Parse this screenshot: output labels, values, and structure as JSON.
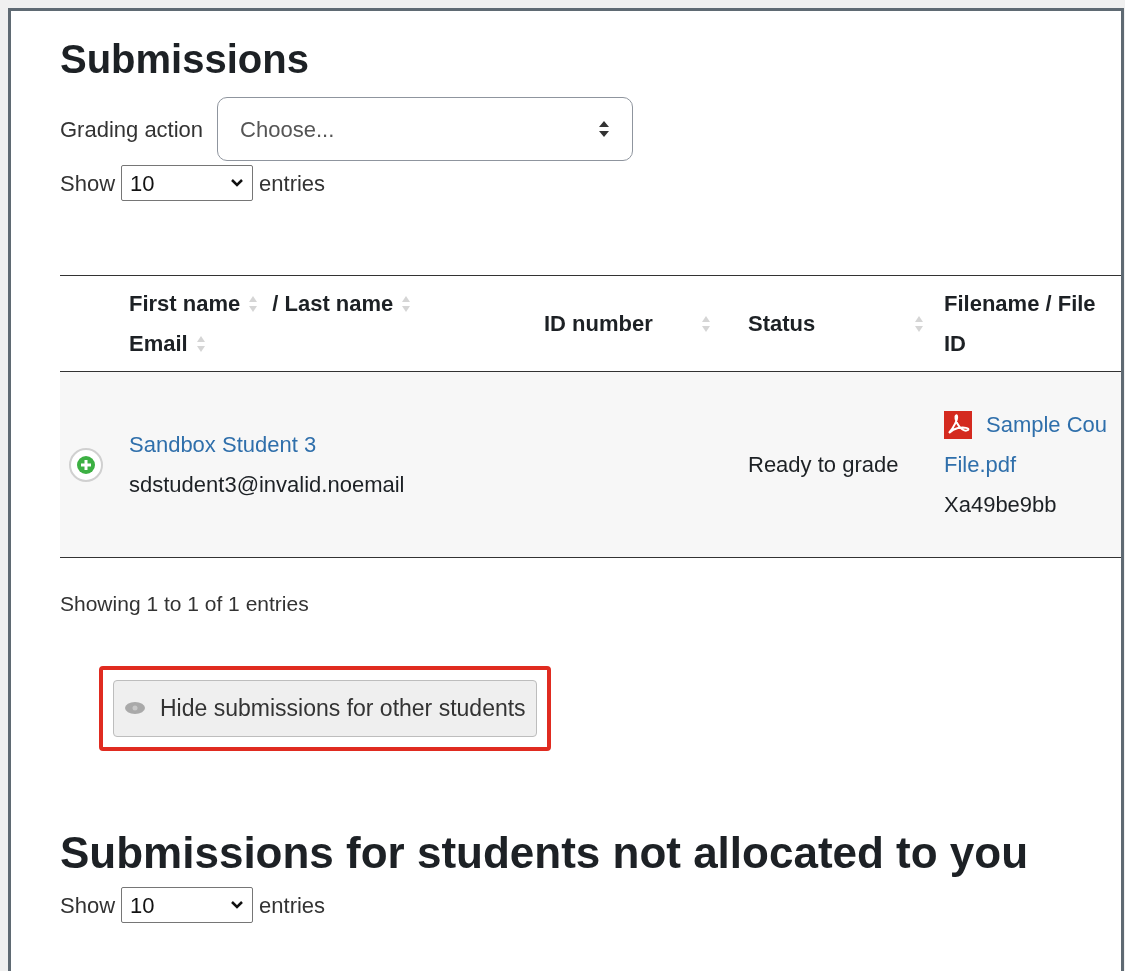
{
  "heading": "Submissions",
  "grading_action": {
    "label": "Grading action",
    "placeholder": "Choose..."
  },
  "show_entries": {
    "before": "Show",
    "value": "10",
    "after": "entries"
  },
  "table": {
    "columns": [
      {
        "kind": "name",
        "parts": [
          "First name",
          "/ Last name",
          "Email"
        ]
      },
      {
        "kind": "plain",
        "label": "ID number"
      },
      {
        "kind": "plain",
        "label": "Status"
      },
      {
        "kind": "file",
        "label": "Filename / File ID"
      }
    ],
    "rows": [
      {
        "expanded": false,
        "name": "Sandbox Student 3",
        "email": "sdstudent3@invalid.noemail",
        "id_number": "",
        "status": "Ready to grade",
        "file_lines": [
          "Sample Cou",
          "File.pdf"
        ],
        "file_id": "Xa49be9bb"
      }
    ]
  },
  "info": "Showing 1 to 1 of 1 entries",
  "toggle_button": {
    "label": "Hide submissions for other students",
    "highlighted": true
  },
  "heading_2": "Submissions for students not allocated to you",
  "show_entries_2": {
    "before": "Show",
    "value": "10",
    "after": "entries"
  }
}
